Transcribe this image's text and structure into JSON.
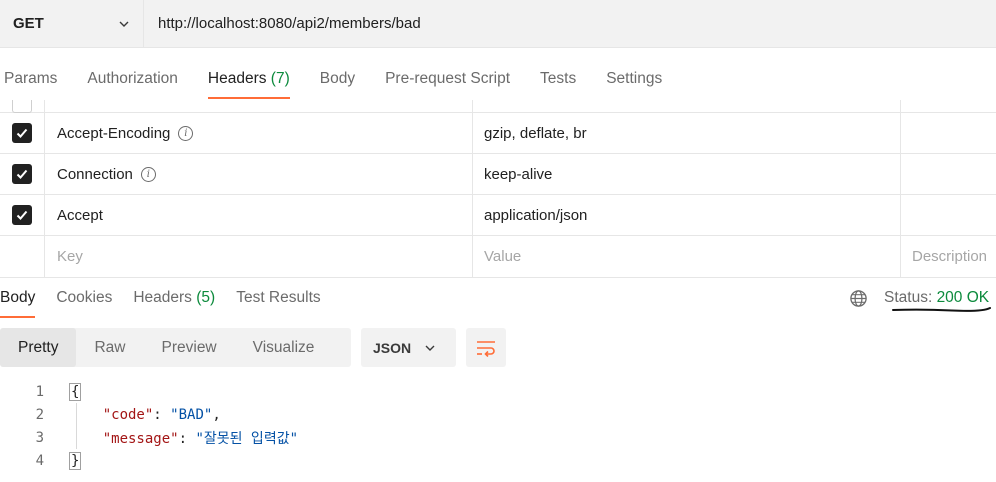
{
  "request": {
    "method": "GET",
    "url": "http://localhost:8080/api2/members/bad"
  },
  "request_tabs": {
    "params": "Params",
    "authorization": "Authorization",
    "headers": "Headers",
    "headers_count": "(7)",
    "body": "Body",
    "prerequest": "Pre-request Script",
    "tests": "Tests",
    "settings": "Settings"
  },
  "headers_table": {
    "rows": [
      {
        "key": "Accept-Encoding",
        "value": "gzip, deflate, br",
        "checked": true
      },
      {
        "key": "Connection",
        "value": "keep-alive",
        "checked": true
      },
      {
        "key": "Accept",
        "value": "application/json",
        "checked": true
      }
    ],
    "placeholder_key": "Key",
    "placeholder_value": "Value",
    "placeholder_description": "Description"
  },
  "response_tabs": {
    "body": "Body",
    "cookies": "Cookies",
    "headers": "Headers",
    "headers_count": "(5)",
    "test_results": "Test Results"
  },
  "status": {
    "label": "Status:",
    "value": "200 OK"
  },
  "view_modes": {
    "pretty": "Pretty",
    "raw": "Raw",
    "preview": "Preview",
    "visualize": "Visualize"
  },
  "format": "JSON",
  "code": {
    "line_numbers": [
      "1",
      "2",
      "3",
      "4"
    ],
    "open_brace": "{",
    "close_brace": "}",
    "key1": "\"code\"",
    "val1": "\"BAD\"",
    "key2": "\"message\"",
    "val2": "\"잘못된 입력값\""
  },
  "colors": {
    "accent": "#ff6c37",
    "success": "#0c8a3c",
    "json_key": "#a31515",
    "json_string": "#0451a5"
  }
}
